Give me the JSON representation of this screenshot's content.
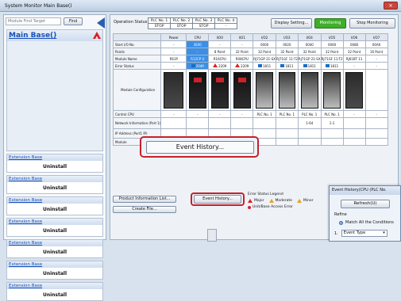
{
  "window": {
    "title": "System Monitor Main Base()"
  },
  "left": {
    "search_placeholder": "Module Find Target",
    "find_label": "Find",
    "main_base": "Main Base()",
    "alert_letter": "A",
    "ext_bases": [
      {
        "title": "Extension Base",
        "action": "Uninstall"
      },
      {
        "title": "Extension Base",
        "action": "Uninstall"
      },
      {
        "title": "Extension Base",
        "action": "Uninstall"
      },
      {
        "title": "Extension Base",
        "action": "Uninstall"
      },
      {
        "title": "Extension Base",
        "action": "Uninstall"
      },
      {
        "title": "Extension Base",
        "action": "Uninstall"
      },
      {
        "title": "Extension Base",
        "action": "Uninstall"
      }
    ]
  },
  "header": {
    "operation_status": "Operation Status",
    "plc_nos": [
      "PLC No. 1",
      "PLC No. 2",
      "PLC No. 3",
      "PLC No. 4"
    ],
    "plc_status": [
      "STOP",
      "STOP",
      "STOP",
      "-"
    ],
    "display_setting": "Display Setting...",
    "monitoring": "Monitoring",
    "stop_monitoring": "Stop Monitoring"
  },
  "grid": {
    "columns": [
      "",
      "Power",
      "CPU",
      "I/O0",
      "I/O1",
      "I/O2",
      "I/O3",
      "I/O4",
      "I/O5",
      "I/O6",
      "I/O7"
    ],
    "rows": [
      {
        "label": "Start I/O No.",
        "cells": [
          "-",
          "3E00",
          "-",
          "-",
          "0000",
          "0020",
          "0040",
          "0060",
          "0080",
          "00A0"
        ]
      },
      {
        "label": "Points",
        "cells": [
          "-",
          "-",
          "8 Point",
          "32 Point",
          "32 Point",
          "32 Point",
          "32 Point",
          "32 Point",
          "32 Point",
          "16 Point"
        ]
      },
      {
        "label": "Module Name",
        "cells": [
          "R61P",
          "R12CP U",
          "R16CPU",
          "R08CPU",
          "RJ71GP 21-SX",
          "RJ71GF 11-T2",
          "RJ71GP 21-SX",
          "RJ71GF 11-T2",
          "RJ61BT 11",
          "-"
        ]
      },
      {
        "label": "Error Status",
        "cells": [
          "-",
          "2049",
          "2209",
          "2209",
          "1811",
          "1811",
          "1811",
          "1811",
          "-",
          "-"
        ]
      }
    ],
    "module_config": "Module Configuration",
    "control_cpu": "Control CPU",
    "control_cells": [
      "-",
      "-",
      "-",
      "-",
      "PLC No. 1",
      "PLC No. 1",
      "PLC No. 1",
      "PLC No. 1",
      "-",
      "-"
    ],
    "network_label": "Network Information (Port 1)",
    "network_cells": [
      "",
      "",
      "",
      "",
      "",
      "",
      "1-64",
      "1-1",
      "",
      ""
    ],
    "ip_label": "IP Address (Port1 IP)",
    "module_label": "Module"
  },
  "tooltip": {
    "text": "Event History..."
  },
  "bottom": {
    "product_info": "Product Information List...",
    "create_file": "Create File...",
    "event_history": "Event History...",
    "legend_title": "Error Status Legend",
    "legend_items": [
      "Major",
      "Moderate",
      "Minor"
    ],
    "unit_error": "Unit/Base Access Error"
  },
  "popup": {
    "title": "Event History(CPU (PLC No.",
    "refresh": "Refresh(U)",
    "refine": "Refine",
    "match_all": "Match All the Conditions",
    "filter_num": "1.",
    "filter_value": "Event Type"
  }
}
